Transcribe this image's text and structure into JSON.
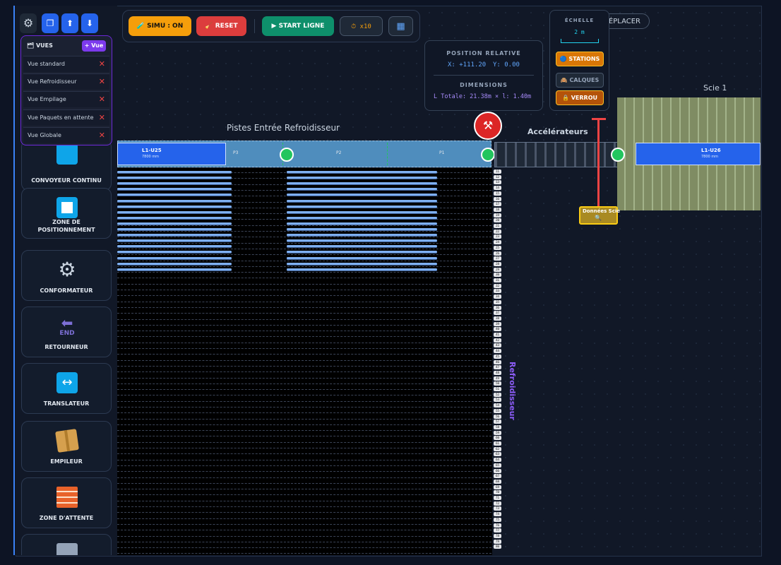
{
  "sidebar": {
    "top_buttons": [
      {
        "icon": "gear-icon",
        "glyph": "⚙"
      },
      {
        "icon": "window-icon",
        "glyph": "❐"
      },
      {
        "icon": "upload-icon",
        "glyph": "⬆"
      },
      {
        "icon": "download-icon",
        "glyph": "⬇"
      }
    ],
    "views_panel": {
      "title": "🗂 VUES",
      "add_label": "+ Vue",
      "items": [
        {
          "label": "Vue standard"
        },
        {
          "label": "Vue Refroidisseur"
        },
        {
          "label": "Vue Empilage"
        },
        {
          "label": "Vue Paquets en attente"
        },
        {
          "label": "Vue Globale"
        }
      ],
      "delete_glyph": "✕"
    },
    "tools": [
      {
        "label": "CONVOYEUR CONTINU",
        "icon": "play-icon"
      },
      {
        "label": "ZONE DE POSITIONNEMENT",
        "icon": "square-icon"
      },
      {
        "label": "CONFORMATEUR",
        "icon": "gear-icon"
      },
      {
        "label": "RETOURNEUR",
        "icon": "arrow-left-end-icon",
        "icon_text": "END"
      },
      {
        "label": "TRANSLATEUR",
        "icon": "arrows-left-right-icon"
      },
      {
        "label": "EMPILEUR",
        "icon": "box-icon"
      },
      {
        "label": "ZONE D'ATTENTE",
        "icon": "brick-wall-icon"
      },
      {
        "label": "",
        "icon": "building-icon"
      }
    ]
  },
  "toolbar": {
    "simu": "🧪 SIMU : ON",
    "reset": "🧹 RESET",
    "start": "▶ START LIGNE",
    "speed": "⏱ x10",
    "grid_icon": "▦"
  },
  "position_panel": {
    "title": "POSITION RELATIVE",
    "x": "X: +111.20",
    "y": "Y: 0.00",
    "dims_title": "DIMENSIONS",
    "dims": "L Totale: 21.38m × l: 1.40m"
  },
  "scale_panel": {
    "title": "ÉCHELLE",
    "value": "2 m",
    "stations": "🔵 STATIONS",
    "calques": "🙈 CALQUES",
    "verrou": "🔒 VERROU"
  },
  "move_button": "DÉPLACER",
  "canvas": {
    "track_title": "Pistes Entrée Refroidisseur",
    "accel_title": "Accélérateurs",
    "saw_title": "Scie 1",
    "cooler_title": "Refroidisseur",
    "saw_data": "Données Scie",
    "product_left": {
      "name": "L1-U25",
      "length": "7800 mm"
    },
    "product_right": {
      "name": "L1-U26",
      "length": "7800 mm"
    },
    "segments": [
      {
        "label": "P3"
      },
      {
        "label": "P2"
      },
      {
        "label": "P1"
      }
    ],
    "rail_numbers": [
      "11",
      "12",
      "13",
      "14",
      "15",
      "16",
      "17",
      "18",
      "19",
      "20",
      "21",
      "22",
      "23",
      "24",
      "25",
      "26",
      "27",
      "28",
      "29",
      "30",
      "31",
      "32",
      "33",
      "34",
      "35",
      "36",
      "37",
      "38",
      "39",
      "40",
      "41",
      "42",
      "43",
      "44",
      "45",
      "46",
      "47",
      "48",
      "49",
      "50",
      "51",
      "52",
      "53",
      "54",
      "55",
      "56",
      "57",
      "58",
      "59",
      "60",
      "61",
      "62",
      "63",
      "64",
      "65",
      "66",
      "67",
      "68",
      "69",
      "70",
      "71",
      "72",
      "73",
      "74",
      "75",
      "76",
      "77",
      "78",
      "79",
      "80"
    ],
    "colors": {
      "accent": "#3b82f6",
      "alarm": "#ef4444",
      "ok": "#22c55e",
      "saw": "#7f8c63"
    }
  }
}
